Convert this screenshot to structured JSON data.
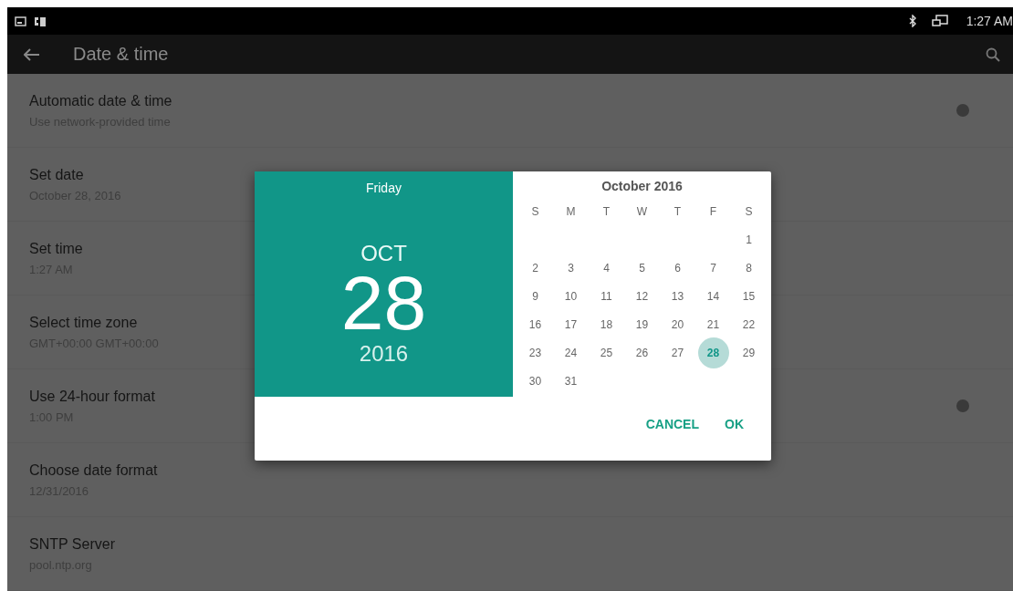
{
  "status_bar": {
    "time": "1:27 AM"
  },
  "toolbar": {
    "title": "Date & time"
  },
  "settings": [
    {
      "title": "Automatic date & time",
      "summary": "Use network-provided time",
      "kind": "switch",
      "on": false
    },
    {
      "title": "Set date",
      "summary": "October 28, 2016",
      "kind": "plain"
    },
    {
      "title": "Set time",
      "summary": "1:27 AM",
      "kind": "plain"
    },
    {
      "title": "Select time zone",
      "summary": "GMT+00:00 GMT+00:00",
      "kind": "plain"
    },
    {
      "title": "Use 24-hour format",
      "summary": "1:00 PM",
      "kind": "switch",
      "on": false
    },
    {
      "title": "Choose date format",
      "summary": "12/31/2016",
      "kind": "plain"
    },
    {
      "title": "SNTP Server",
      "summary": "pool.ntp.org",
      "kind": "plain"
    }
  ],
  "date_dialog": {
    "weekday": "Friday",
    "month": "OCT",
    "day": "28",
    "year": "2016",
    "calendar_title": "October 2016",
    "weekday_headers": [
      "S",
      "M",
      "T",
      "W",
      "T",
      "F",
      "S"
    ],
    "weeks": [
      {
        "kind": "partial",
        "days": [
          {
            "label": "1",
            "selected": false
          }
        ]
      },
      {
        "kind": "full",
        "days": [
          {
            "label": "2",
            "selected": false
          },
          {
            "label": "3",
            "selected": false
          },
          {
            "label": "4",
            "selected": false
          },
          {
            "label": "5",
            "selected": false
          },
          {
            "label": "6",
            "selected": false
          },
          {
            "label": "7",
            "selected": false
          },
          {
            "label": "8",
            "selected": false
          }
        ]
      },
      {
        "kind": "full",
        "days": [
          {
            "label": "9",
            "selected": false
          },
          {
            "label": "10",
            "selected": false
          },
          {
            "label": "11",
            "selected": false
          },
          {
            "label": "12",
            "selected": false
          },
          {
            "label": "13",
            "selected": false
          },
          {
            "label": "14",
            "selected": false
          },
          {
            "label": "15",
            "selected": false
          }
        ]
      },
      {
        "kind": "full",
        "days": [
          {
            "label": "16",
            "selected": false
          },
          {
            "label": "17",
            "selected": false
          },
          {
            "label": "18",
            "selected": false
          },
          {
            "label": "19",
            "selected": false
          },
          {
            "label": "20",
            "selected": false
          },
          {
            "label": "21",
            "selected": false
          },
          {
            "label": "22",
            "selected": false
          }
        ]
      },
      {
        "kind": "full",
        "days": [
          {
            "label": "23",
            "selected": false
          },
          {
            "label": "24",
            "selected": false
          },
          {
            "label": "25",
            "selected": false
          },
          {
            "label": "26",
            "selected": false
          },
          {
            "label": "27",
            "selected": false
          },
          {
            "label": "28",
            "selected": true
          },
          {
            "label": "29",
            "selected": false
          }
        ]
      },
      {
        "kind": "full",
        "days": [
          {
            "label": "30",
            "selected": false
          },
          {
            "label": "31",
            "selected": false
          }
        ]
      }
    ],
    "buttons": [
      "CANCEL",
      "OK"
    ]
  }
}
